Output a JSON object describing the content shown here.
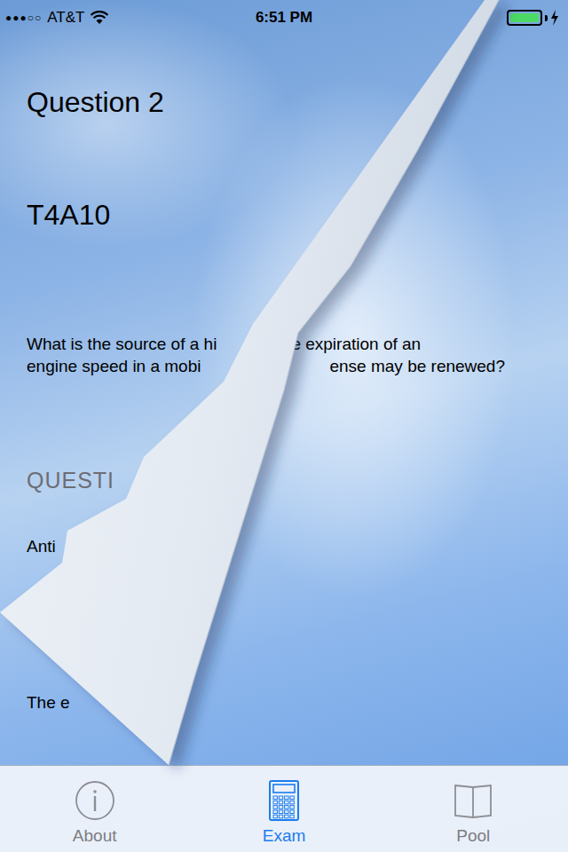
{
  "status_bar": {
    "signal": "●●●○○",
    "carrier": "AT&T",
    "time": "6:51 PM",
    "battery": {
      "level": 1,
      "charging": true
    }
  },
  "question": {
    "title": "Question 2",
    "code": "T4A10",
    "lines": [
      {
        "left": "What is the source of a hi",
        "right": "e expiration of an"
      },
      {
        "left": "engine speed in a mobi",
        "right": "ense may be renewed?"
      }
    ]
  },
  "answers_heading": "QUESTI",
  "answers": [
    "Anti",
    "The e"
  ],
  "tabs": [
    {
      "label": "About",
      "selected": false,
      "kind": "info"
    },
    {
      "label": "Exam",
      "selected": true,
      "kind": "calculator"
    },
    {
      "label": "Pool",
      "selected": false,
      "kind": "book"
    }
  ]
}
